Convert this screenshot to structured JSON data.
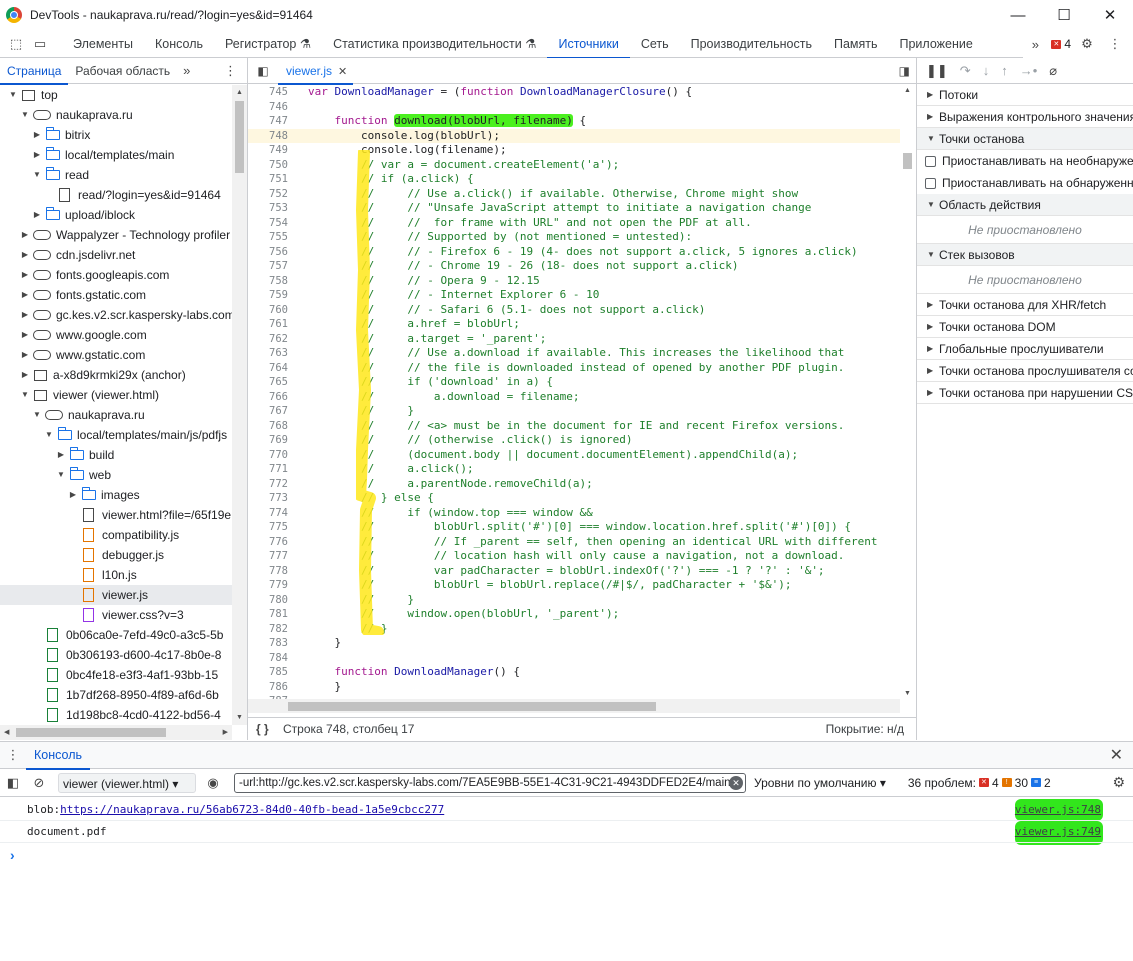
{
  "window": {
    "title": "DevTools - naukaprava.ru/read/?login=yes&id=91464"
  },
  "main_tabs": [
    "Элементы",
    "Консоль",
    "Регистратор",
    "Статистика производительности",
    "Источники",
    "Сеть",
    "Производительность",
    "Память",
    "Приложение"
  ],
  "active_main_tab": "Источники",
  "error_count": "4",
  "left_tabs": {
    "page": "Страница",
    "workspace": "Рабочая область"
  },
  "tree": [
    {
      "label": "top",
      "icon": "top",
      "indent": 0,
      "tw": "▼"
    },
    {
      "label": "naukaprava.ru",
      "icon": "cloud",
      "indent": 1,
      "tw": "▼"
    },
    {
      "label": "bitrix",
      "icon": "folder",
      "indent": 2,
      "tw": "▶"
    },
    {
      "label": "local/templates/main",
      "icon": "folder",
      "indent": 2,
      "tw": "▶"
    },
    {
      "label": "read",
      "icon": "folder",
      "indent": 2,
      "tw": "▼"
    },
    {
      "label": "read/?login=yes&id=91464",
      "icon": "file",
      "indent": 3,
      "tw": ""
    },
    {
      "label": "upload/iblock",
      "icon": "folder",
      "indent": 2,
      "tw": "▶"
    },
    {
      "label": "Wappalyzer - Technology profiler",
      "icon": "cloud",
      "indent": 1,
      "tw": "▶"
    },
    {
      "label": "cdn.jsdelivr.net",
      "icon": "cloud",
      "indent": 1,
      "tw": "▶"
    },
    {
      "label": "fonts.googleapis.com",
      "icon": "cloud",
      "indent": 1,
      "tw": "▶"
    },
    {
      "label": "fonts.gstatic.com",
      "icon": "cloud",
      "indent": 1,
      "tw": "▶"
    },
    {
      "label": "gc.kes.v2.scr.kaspersky-labs.com",
      "icon": "cloud",
      "indent": 1,
      "tw": "▶"
    },
    {
      "label": "www.google.com",
      "icon": "cloud",
      "indent": 1,
      "tw": "▶"
    },
    {
      "label": "www.gstatic.com",
      "icon": "cloud",
      "indent": 1,
      "tw": "▶"
    },
    {
      "label": "a-x8d9krmki29x (anchor)",
      "icon": "top",
      "indent": 1,
      "tw": "▶"
    },
    {
      "label": "viewer (viewer.html)",
      "icon": "top",
      "indent": 1,
      "tw": "▼"
    },
    {
      "label": "naukaprava.ru",
      "icon": "cloud",
      "indent": 2,
      "tw": "▼"
    },
    {
      "label": "local/templates/main/js/pdfjs",
      "icon": "folder",
      "indent": 3,
      "tw": "▼"
    },
    {
      "label": "build",
      "icon": "folder",
      "indent": 4,
      "tw": "▶"
    },
    {
      "label": "web",
      "icon": "folder",
      "indent": 4,
      "tw": "▼"
    },
    {
      "label": "images",
      "icon": "folder",
      "indent": 5,
      "tw": "▶"
    },
    {
      "label": "viewer.html?file=/65f19e",
      "icon": "file",
      "indent": 5,
      "tw": ""
    },
    {
      "label": "compatibility.js",
      "icon": "file-orange",
      "indent": 5,
      "tw": ""
    },
    {
      "label": "debugger.js",
      "icon": "file-orange",
      "indent": 5,
      "tw": ""
    },
    {
      "label": "l10n.js",
      "icon": "file-orange",
      "indent": 5,
      "tw": ""
    },
    {
      "label": "viewer.js",
      "icon": "file-orange",
      "indent": 5,
      "tw": "",
      "selected": true
    },
    {
      "label": "viewer.css?v=3",
      "icon": "file-purple",
      "indent": 5,
      "tw": ""
    },
    {
      "label": "0b06ca0e-7efd-49c0-a3c5-5b",
      "icon": "file-green",
      "indent": 2,
      "tw": ""
    },
    {
      "label": "0b306193-d600-4c17-8b0e-8",
      "icon": "file-green",
      "indent": 2,
      "tw": ""
    },
    {
      "label": "0bc4fe18-e3f3-4af1-93bb-15",
      "icon": "file-green",
      "indent": 2,
      "tw": ""
    },
    {
      "label": "1b7df268-8950-4f89-af6d-6b",
      "icon": "file-green",
      "indent": 2,
      "tw": ""
    },
    {
      "label": "1d198bc8-4cd0-4122-bd56-4",
      "icon": "file-green",
      "indent": 2,
      "tw": ""
    }
  ],
  "editor": {
    "file_tab": "viewer.js",
    "status_position": "Строка 748, столбец 17",
    "coverage": "Покрытие: н/д",
    "current_line": 748,
    "lines": [
      {
        "n": 745,
        "t": "var DownloadManager = (function DownloadManagerClosure() {"
      },
      {
        "n": 746,
        "t": ""
      },
      {
        "n": 747,
        "t": "    function download(blobUrl, filename) {",
        "hl": "download(blobUrl, filename)"
      },
      {
        "n": 748,
        "t": "        console.log(blobUrl);"
      },
      {
        "n": 749,
        "t": "        console.log(filename);"
      },
      {
        "n": 750,
        "t": "        // var a = document.createElement('a');"
      },
      {
        "n": 751,
        "t": "        // if (a.click) {"
      },
      {
        "n": 752,
        "t": "        //     // Use a.click() if available. Otherwise, Chrome might show"
      },
      {
        "n": 753,
        "t": "        //     // \"Unsafe JavaScript attempt to initiate a navigation change"
      },
      {
        "n": 754,
        "t": "        //     //  for frame with URL\" and not open the PDF at all."
      },
      {
        "n": 755,
        "t": "        //     // Supported by (not mentioned = untested):"
      },
      {
        "n": 756,
        "t": "        //     // - Firefox 6 - 19 (4- does not support a.click, 5 ignores a.click)"
      },
      {
        "n": 757,
        "t": "        //     // - Chrome 19 - 26 (18- does not support a.click)"
      },
      {
        "n": 758,
        "t": "        //     // - Opera 9 - 12.15"
      },
      {
        "n": 759,
        "t": "        //     // - Internet Explorer 6 - 10"
      },
      {
        "n": 760,
        "t": "        //     // - Safari 6 (5.1- does not support a.click)"
      },
      {
        "n": 761,
        "t": "        //     a.href = blobUrl;"
      },
      {
        "n": 762,
        "t": "        //     a.target = '_parent';"
      },
      {
        "n": 763,
        "t": "        //     // Use a.download if available. This increases the likelihood that"
      },
      {
        "n": 764,
        "t": "        //     // the file is downloaded instead of opened by another PDF plugin."
      },
      {
        "n": 765,
        "t": "        //     if ('download' in a) {"
      },
      {
        "n": 766,
        "t": "        //         a.download = filename;"
      },
      {
        "n": 767,
        "t": "        //     }"
      },
      {
        "n": 768,
        "t": "        //     // <a> must be in the document for IE and recent Firefox versions."
      },
      {
        "n": 769,
        "t": "        //     // (otherwise .click() is ignored)"
      },
      {
        "n": 770,
        "t": "        //     (document.body || document.documentElement).appendChild(a);"
      },
      {
        "n": 771,
        "t": "        //     a.click();"
      },
      {
        "n": 772,
        "t": "        //     a.parentNode.removeChild(a);"
      },
      {
        "n": 773,
        "t": "        // } else {"
      },
      {
        "n": 774,
        "t": "        //     if (window.top === window &&"
      },
      {
        "n": 775,
        "t": "        //         blobUrl.split('#')[0] === window.location.href.split('#')[0]) {"
      },
      {
        "n": 776,
        "t": "        //         // If _parent == self, then opening an identical URL with different"
      },
      {
        "n": 777,
        "t": "        //         // location hash will only cause a navigation, not a download."
      },
      {
        "n": 778,
        "t": "        //         var padCharacter = blobUrl.indexOf('?') === -1 ? '?' : '&';"
      },
      {
        "n": 779,
        "t": "        //         blobUrl = blobUrl.replace(/#|$/, padCharacter + '$&');"
      },
      {
        "n": 780,
        "t": "        //     }"
      },
      {
        "n": 781,
        "t": "        //     window.open(blobUrl, '_parent');"
      },
      {
        "n": 782,
        "t": "        // }"
      },
      {
        "n": 783,
        "t": "    }"
      },
      {
        "n": 784,
        "t": ""
      },
      {
        "n": 785,
        "t": "    function DownloadManager() {"
      },
      {
        "n": 786,
        "t": "    }"
      },
      {
        "n": 787,
        "t": ""
      }
    ]
  },
  "debug_sections": [
    {
      "type": "sect",
      "label": "Потоки",
      "tri": "▶"
    },
    {
      "type": "sect",
      "label": "Выражения контрольного значения",
      "tri": "▶"
    },
    {
      "type": "sect",
      "label": "Точки останова",
      "tri": "▼",
      "open": true
    },
    {
      "type": "chk",
      "label": "Приостанавливать на необнаруженных исключениях"
    },
    {
      "type": "chk",
      "label": "Приостанавливать на обнаруженных исключениях"
    },
    {
      "type": "sect",
      "label": "Область действия",
      "tri": "▼",
      "open": true
    },
    {
      "type": "np",
      "label": "Не приостановлено"
    },
    {
      "type": "sect",
      "label": "Стек вызовов",
      "tri": "▼",
      "open": true
    },
    {
      "type": "np",
      "label": "Не приостановлено"
    },
    {
      "type": "sect",
      "label": "Точки останова для XHR/fetch",
      "tri": "▶"
    },
    {
      "type": "sect",
      "label": "Точки останова DOM",
      "tri": "▶"
    },
    {
      "type": "sect",
      "label": "Глобальные прослушиватели",
      "tri": "▶"
    },
    {
      "type": "sect",
      "label": "Точки останова прослушивателя событий",
      "tri": "▶"
    },
    {
      "type": "sect",
      "label": "Точки останова при нарушении CSP",
      "tri": "▶"
    }
  ],
  "drawer": {
    "tab": "Консоль",
    "context": "viewer (viewer.html)",
    "filter": "-url:http://gc.kes.v2.scr.kaspersky-labs.com/7EA5E9BB-55E1-4C31-9C21-4943DDFED2E4/main",
    "levels": "Уровни по умолчанию",
    "issues_label": "36 проблем:",
    "issues_errors": "4",
    "issues_warnings": "30",
    "issues_info": "2",
    "messages": [
      {
        "prefix": "blob:",
        "link": "https://naukaprava.ru/56ab6723-84d0-40fb-bead-1a5e9cbcc277",
        "src": "viewer.js:748"
      },
      {
        "prefix": "document.pdf",
        "link": "",
        "src": "viewer.js:749"
      }
    ]
  },
  "colors": {
    "accent": "#0b57d0",
    "highlight_green": "#32e61c",
    "highlight_yellow": "#ffe81a"
  }
}
